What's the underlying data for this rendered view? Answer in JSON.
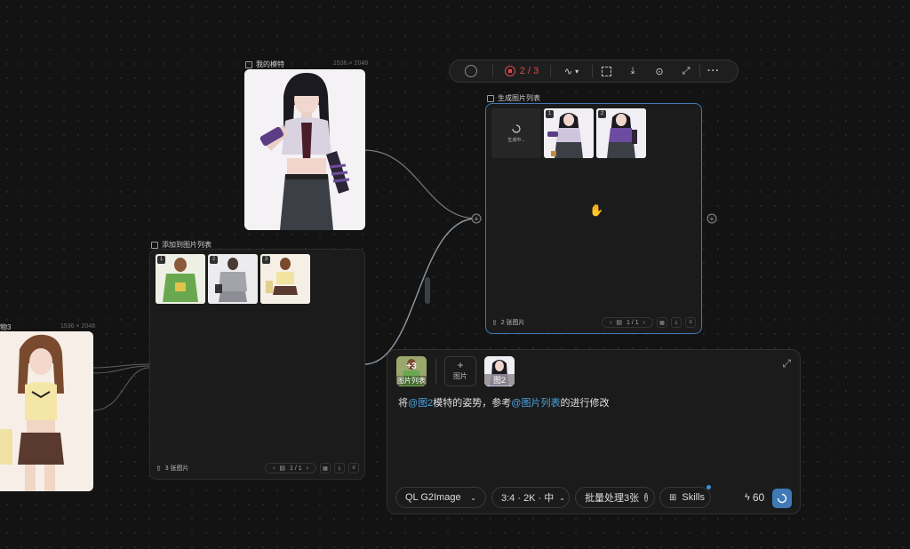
{
  "model_node": {
    "title": "我的模特",
    "dims": "1536 × 2048"
  },
  "left_node": {
    "title": "物3",
    "dims": "1536 × 2048"
  },
  "add_list_node": {
    "title": "添加到图片列表",
    "thumbs": [
      "1",
      "2",
      "3"
    ],
    "footer_count": "3 张图片",
    "pager": "1 / 1"
  },
  "gen_list_node": {
    "title": "生成图片列表",
    "loading_text": "生成中...",
    "thumbs": [
      "1",
      "2"
    ],
    "footer_count": "2 张图片",
    "pager": "1 / 1"
  },
  "toolbar": {
    "run_count": "2 / 3"
  },
  "prompt_panel": {
    "chips": {
      "image_list_badge": "+3",
      "image_list_label": "图片列表",
      "add_plus": "+",
      "add_label": "图片",
      "image2_label": "图2"
    },
    "text": {
      "part1": "将",
      "mention1": "@图2",
      "part2": "模特的姿势，参考",
      "mention2": "@图片列表",
      "part3": "的进行修改"
    },
    "model_select": "QL G2Image",
    "ratio_select": "3:4 · 2K · 中",
    "batch_label": "批量处理3张",
    "skills_label": "Skills",
    "credits": "60"
  },
  "colors": {
    "accent_blue": "#3f79b6",
    "mention": "#4aa3e0",
    "run_red": "#e04848",
    "background": "#131313"
  }
}
